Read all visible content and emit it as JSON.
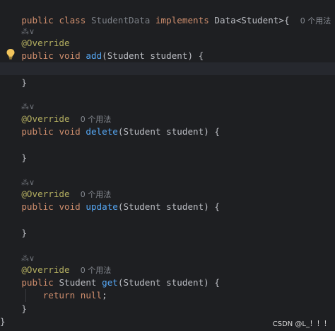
{
  "class_header": {
    "public": "public",
    "class": "class",
    "class_name": "StudentData",
    "implements": "implements",
    "interface": "Data<Student>{",
    "usages": "0 个用法"
  },
  "methods": [
    {
      "annotation": "@Override",
      "usages": "",
      "public": "public",
      "return_type": "void",
      "name": "add",
      "params": "(Student student) {",
      "body": "",
      "close": "}"
    },
    {
      "annotation": "@Override",
      "usages": "0 个用法",
      "public": "public",
      "return_type": "void",
      "name": "delete",
      "params": "(Student student) {",
      "body": "",
      "close": "}"
    },
    {
      "annotation": "@Override",
      "usages": "0 个用法",
      "public": "public",
      "return_type": "void",
      "name": "update",
      "params": "(Student student) {",
      "body": "",
      "close": "}"
    },
    {
      "annotation": "@Override",
      "usages": "0 个用法",
      "public": "public",
      "return_type": "Student",
      "name": "get",
      "params": "(Student student) {",
      "body_return": "return",
      "body_null": "null",
      "body_semicolon": ";",
      "close": "}"
    }
  ],
  "class_close": "}",
  "inlay_marker": "⁂∨",
  "watermark": "CSDN @L_！！！",
  "colors": {
    "background": "#1e1f22",
    "keyword": "#cf8e6d",
    "annotation": "#b3ae60",
    "function": "#56a8f5",
    "text": "#bcbec4"
  }
}
